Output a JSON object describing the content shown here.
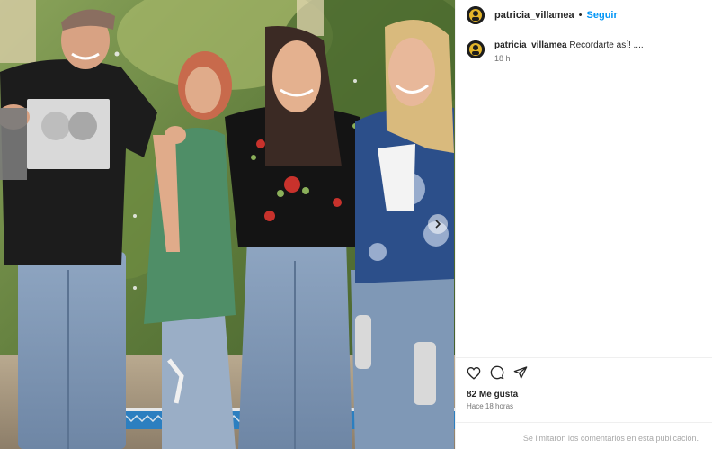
{
  "post": {
    "author": {
      "username": "patricia_villamea",
      "follow_label": "Seguir",
      "separator": "•"
    },
    "caption": {
      "username": "patricia_villamea",
      "text": "Recordarte así! ....",
      "time": "18 h"
    },
    "actions": [
      "heart-icon",
      "comment-icon",
      "share-icon"
    ],
    "likes": "82 Me gusta",
    "posted": "Hace 18 horas",
    "comments_notice": "Se limitaron los comentarios en esta publicación."
  },
  "colors": {
    "link": "#0095f6",
    "text": "#262626",
    "muted": "#737373",
    "faint": "#a8a8a8",
    "border": "#efefef"
  }
}
